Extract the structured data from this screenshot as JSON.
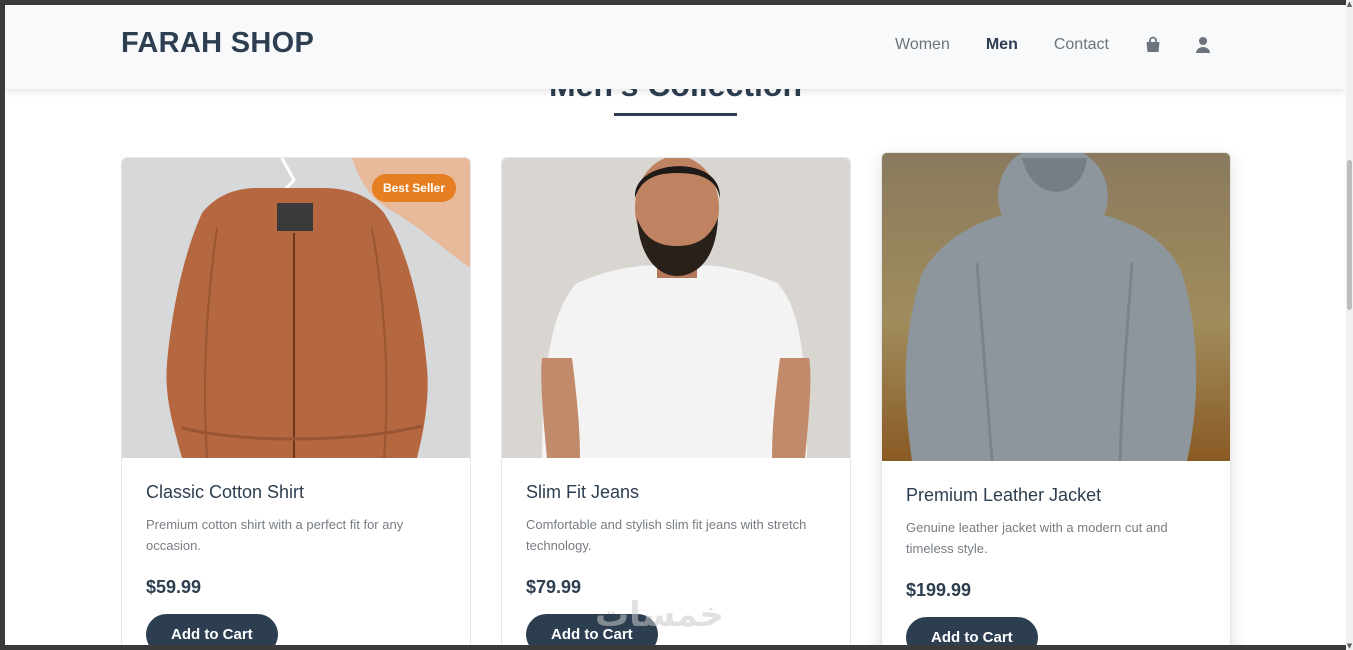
{
  "header": {
    "brand": "FARAH SHOP",
    "nav": [
      {
        "label": "Women",
        "active": false
      },
      {
        "label": "Men",
        "active": true
      },
      {
        "label": "Contact",
        "active": false
      }
    ],
    "icons": [
      "shopping-bag-icon",
      "user-icon"
    ]
  },
  "section": {
    "title": "Men's Collection"
  },
  "products": [
    {
      "name": "Classic Cotton Shirt",
      "description": "Premium cotton shirt with a perfect fit for any occasion.",
      "price": "$59.99",
      "badge": "Best Seller",
      "button": "Add to Cart",
      "image": "rust-bomber-jacket-on-hanger"
    },
    {
      "name": "Slim Fit Jeans",
      "description": "Comfortable and stylish slim fit jeans with stretch technology.",
      "price": "$79.99",
      "badge": "",
      "button": "Add to Cart",
      "image": "bearded-man-white-tshirt"
    },
    {
      "name": "Premium Leather Jacket",
      "description": "Genuine leather jacket with a modern cut and timeless style.",
      "price": "$199.99",
      "badge": "",
      "button": "Add to Cart",
      "image": "grey-hoodie-back-view"
    }
  ],
  "watermark": "خمسات",
  "colors": {
    "brand": "#2c3e50",
    "badge": "#e67e22",
    "header_bg": "#f8f9fa"
  }
}
